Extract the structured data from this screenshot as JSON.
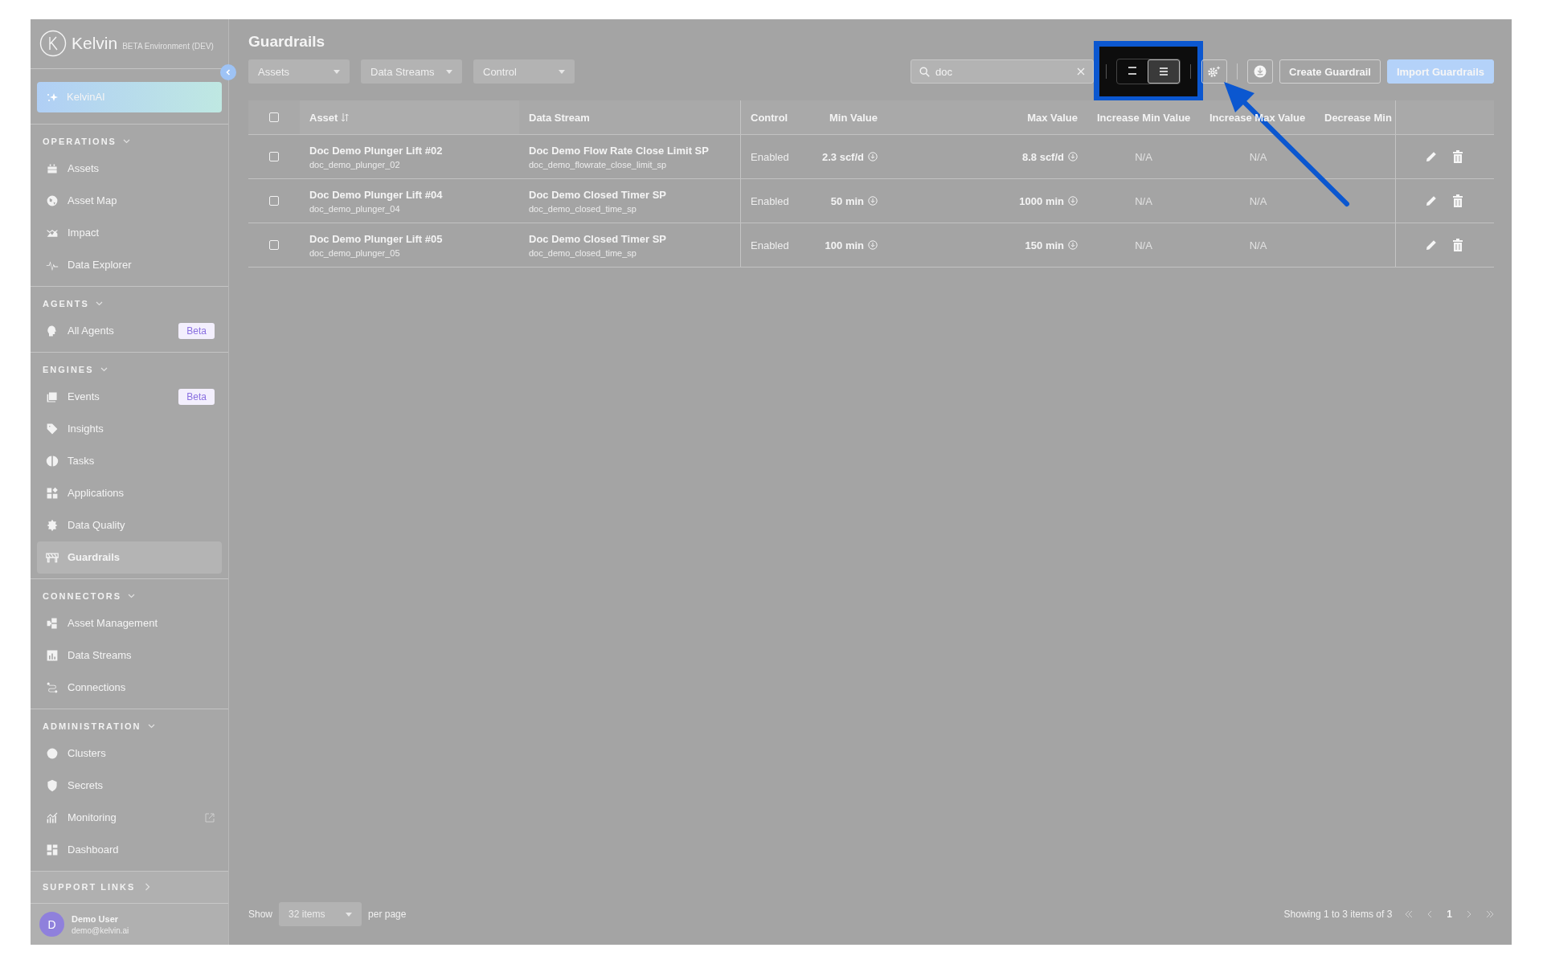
{
  "sidebar": {
    "logo": "Kelvin",
    "environment": "BETA Environment (DEV)",
    "ai_item": "KelvinAI",
    "sections": [
      {
        "title": "OPERATIONS",
        "expanded": true,
        "items": [
          {
            "label": "Assets",
            "selected": false
          },
          {
            "label": "Asset Map",
            "selected": false
          },
          {
            "label": "Impact",
            "selected": false
          },
          {
            "label": "Data Explorer",
            "selected": false
          }
        ]
      },
      {
        "title": "AGENTS",
        "expanded": true,
        "items": [
          {
            "label": "All Agents",
            "selected": false,
            "badge": "Beta"
          }
        ]
      },
      {
        "title": "ENGINES",
        "expanded": true,
        "items": [
          {
            "label": "Events",
            "selected": false,
            "badge": "Beta"
          },
          {
            "label": "Insights",
            "selected": false
          },
          {
            "label": "Tasks",
            "selected": false
          },
          {
            "label": "Applications",
            "selected": false
          },
          {
            "label": "Data Quality",
            "selected": false
          },
          {
            "label": "Guardrails",
            "selected": true
          }
        ]
      },
      {
        "title": "CONNECTORS",
        "expanded": true,
        "items": [
          {
            "label": "Asset Management",
            "selected": false
          },
          {
            "label": "Data Streams",
            "selected": false
          },
          {
            "label": "Connections",
            "selected": false
          }
        ]
      },
      {
        "title": "ADMINISTRATION",
        "expanded": true,
        "items": [
          {
            "label": "Clusters",
            "selected": false
          },
          {
            "label": "Secrets",
            "selected": false
          },
          {
            "label": "Monitoring",
            "selected": false,
            "external": true
          },
          {
            "label": "Dashboard",
            "selected": false
          }
        ]
      }
    ],
    "support_links": {
      "title": "SUPPORT LINKS",
      "expanded": false
    },
    "user": {
      "initial": "D",
      "name": "Demo User",
      "email": "demo@kelvin.ai"
    }
  },
  "page": {
    "title": "Guardrails"
  },
  "filters": [
    "Assets",
    "Data Streams",
    "Control"
  ],
  "search": {
    "value": "doc"
  },
  "view_toggle": [
    {
      "kind": "compact",
      "selected": false
    },
    {
      "kind": "list",
      "selected": true
    }
  ],
  "buttons": [
    {
      "kind": "secondary",
      "label": "Create Guardrail"
    },
    {
      "kind": "primary",
      "label": "Import Guardrails"
    }
  ],
  "table": {
    "all_checked": false,
    "columns": [
      "Asset",
      "Data Stream",
      "Control",
      "Min Value",
      "Max Value",
      "Increase Min Value",
      "Increase Max Value",
      "Decrease Min"
    ],
    "rows": [
      {
        "checked": false,
        "asset": "Doc Demo Plunger Lift #02",
        "asset_id": "doc_demo_plunger_02",
        "stream": "Doc Demo Flow Rate Close Limit SP",
        "stream_id": "doc_demo_flowrate_close_limit_sp",
        "control": "Enabled",
        "min": "2.3 scf/d",
        "max": "8.8 scf/d",
        "inc_min": "N/A",
        "inc_max": "N/A"
      },
      {
        "checked": false,
        "asset": "Doc Demo Plunger Lift #04",
        "asset_id": "doc_demo_plunger_04",
        "stream": "Doc Demo Closed Timer SP",
        "stream_id": "doc_demo_closed_time_sp",
        "control": "Enabled",
        "min": "50 min",
        "max": "1000 min",
        "inc_min": "N/A",
        "inc_max": "N/A"
      },
      {
        "checked": false,
        "asset": "Doc Demo Plunger Lift #05",
        "asset_id": "doc_demo_plunger_05",
        "stream": "Doc Demo Closed Timer SP",
        "stream_id": "doc_demo_closed_time_sp",
        "control": "Enabled",
        "min": "100 min",
        "max": "150 min",
        "inc_min": "N/A",
        "inc_max": "N/A"
      }
    ]
  },
  "pagination": {
    "show": "Show",
    "page_size": "32 items",
    "per_page": "per page",
    "summary": "Showing 1 to 3 items of 3",
    "current": "1"
  }
}
